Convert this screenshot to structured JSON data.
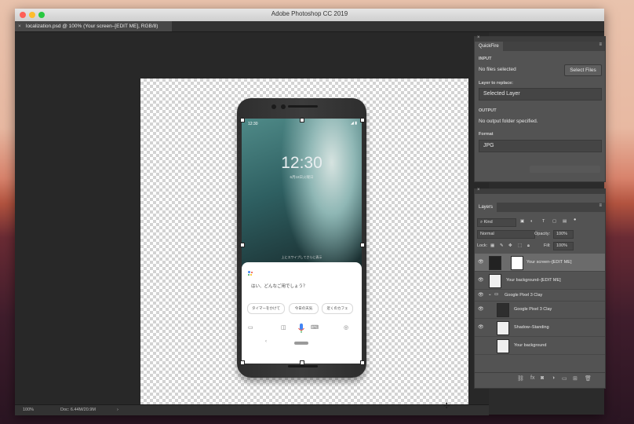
{
  "window": {
    "title": "Adobe Photoshop CC 2019",
    "document_tab": "localization.psd @ 100% (Your screen–[EDIT ME], RGB/8)",
    "tab_close": "×"
  },
  "phone_screen": {
    "status_time": "12:30",
    "status_icons": "◢ ▮",
    "clock": "12:30",
    "date": "6月18日火曜日",
    "swipe_hint": "上にスワイプしてさらに表示",
    "assistant_prompt": "はい、どんなご用でしょう？",
    "chips": [
      "タイマーをかけて",
      "今日の天気",
      "近くのカフェ"
    ],
    "nav_back": "‹"
  },
  "quickfire": {
    "tab": "QuickFire",
    "menu_icon": "≡",
    "close_icon": "×",
    "input_header": "INPUT",
    "no_files": "No files selected",
    "select_files": "Select Files",
    "layer_to_replace": "Layer to replace:",
    "selected_layer": "Selected Layer",
    "output_header": "OUTPUT",
    "no_output": "No output folder specified.",
    "format_label": "Format",
    "format_value": "JPG"
  },
  "layers": {
    "tab": "Layers",
    "menu_icon": "≡",
    "kind": "Kind",
    "blend_mode": "Normal",
    "opacity_label": "Opacity:",
    "opacity_value": "100%",
    "lock_label": "Lock:",
    "fill_label": "Fill:",
    "fill_value": "100%",
    "rows": [
      {
        "name": "Your screen–[EDIT ME]"
      },
      {
        "name": "Your background–[EDIT ME]"
      },
      {
        "name": "Google Pixel 3 Clay"
      },
      {
        "name": "Google Pixel 3 Clay"
      },
      {
        "name": "Shadow–Standing"
      },
      {
        "name": "Your background"
      }
    ],
    "footer_fx": "fx"
  },
  "statusbar": {
    "zoom": "100%",
    "doc": "Doc: 6.44M/20.9M",
    "arrow": "›"
  },
  "colors": {
    "assistant_blue": "#4285f4",
    "assistant_red": "#ea4335",
    "assistant_yellow": "#fbbc04",
    "assistant_green": "#34a853"
  }
}
